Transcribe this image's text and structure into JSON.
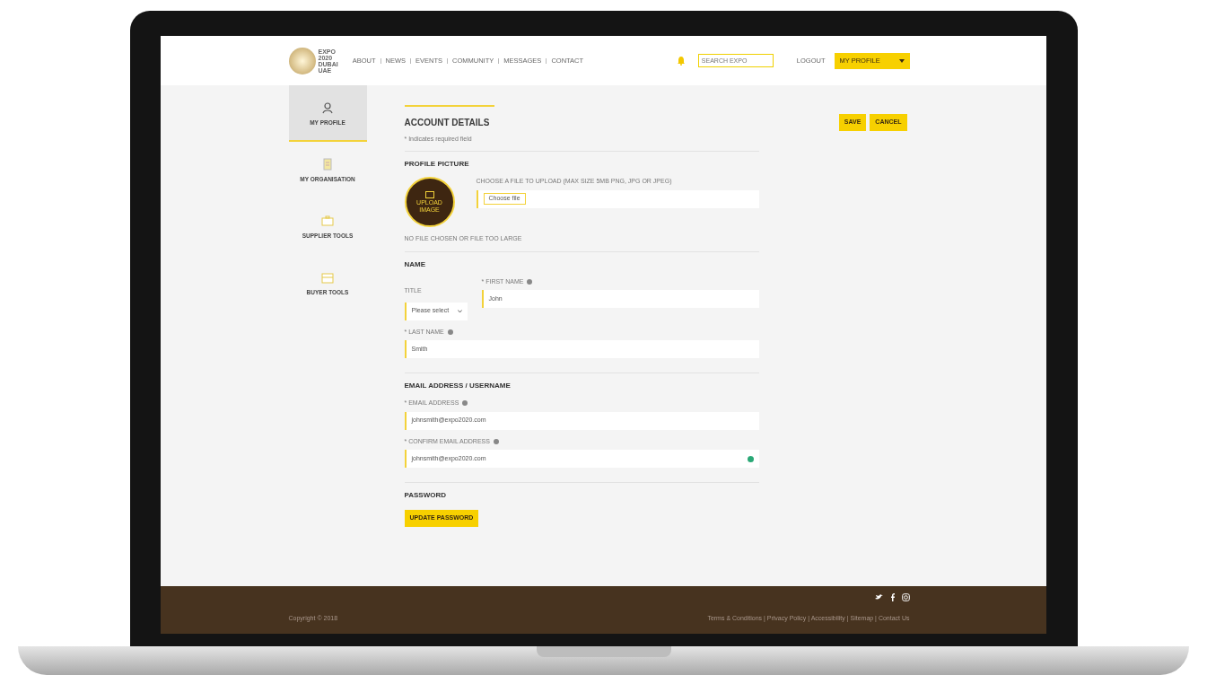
{
  "header": {
    "logo": [
      "EXPO",
      "2020",
      "DUBAI",
      "UAE"
    ],
    "nav": [
      {
        "label": "ABOUT"
      },
      {
        "label": "NEWS"
      },
      {
        "label": "EVENTS"
      },
      {
        "label": "COMMUNITY"
      },
      {
        "label": "MESSAGES"
      },
      {
        "label": "CONTACT"
      }
    ],
    "search": {
      "placeholder": "SEARCH EXPO"
    },
    "logout": "LOGOUT",
    "profile_button": "MY PROFILE"
  },
  "sidebar": {
    "items": [
      {
        "label": "MY PROFILE",
        "selected": true
      },
      {
        "label": "MY ORGANISATION",
        "selected": false
      },
      {
        "label": "SUPPLIER TOOLS",
        "selected": false
      },
      {
        "label": "BUYER TOOLS",
        "selected": false
      }
    ]
  },
  "page": {
    "title": "ACCOUNT DETAILS",
    "note": "* Indicates required field",
    "buttons": [
      "SAVE",
      "CANCEL"
    ],
    "profile_picture": {
      "heading": "PROFILE PICTURE",
      "avatar_text": "UPLOAD IMAGE",
      "upload_label": "CHOOSE A FILE TO UPLOAD (MAX SIZE 5MB PNG, JPG OR JPEG)",
      "file_button": "Choose file",
      "hint": "NO FILE CHOSEN OR FILE TOO LARGE"
    },
    "name": {
      "heading": "NAME",
      "title_label": "TITLE",
      "title_value": "Please select",
      "first_label": "* FIRST NAME",
      "first_value": "John",
      "last_label": "* LAST NAME",
      "last_value": "Smith"
    },
    "email": {
      "heading": "EMAIL ADDRESS / USERNAME",
      "email_label": "* EMAIL ADDRESS",
      "email_value": "johnsmith@expo2020.com",
      "confirm_label": "* CONFIRM EMAIL ADDRESS",
      "confirm_value": "johnsmith@expo2020.com",
      "confirm_valid": true
    },
    "password": {
      "heading": "PASSWORD",
      "button": "UPDATE PASSWORD"
    }
  },
  "footer": {
    "copyright": "Copyright © 2018",
    "links": "Terms & Conditions | Privacy Policy | Accessibility | Sitemap | Contact Us"
  }
}
